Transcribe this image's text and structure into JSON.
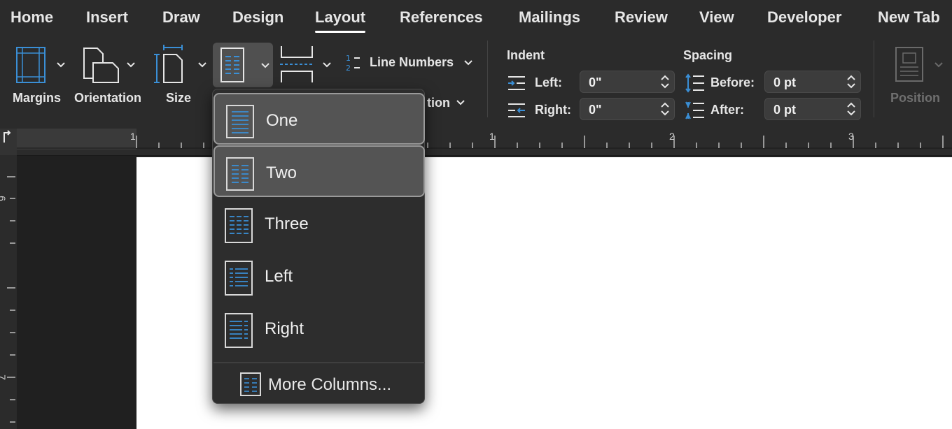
{
  "menubar": {
    "tabs": [
      {
        "label": "Home"
      },
      {
        "label": "Insert"
      },
      {
        "label": "Draw"
      },
      {
        "label": "Design"
      },
      {
        "label": "Layout",
        "active": true
      },
      {
        "label": "References"
      },
      {
        "label": "Mailings"
      },
      {
        "label": "Review"
      },
      {
        "label": "View"
      },
      {
        "label": "Developer"
      },
      {
        "label": "New Tab"
      }
    ]
  },
  "ribbon": {
    "margins_label": "Margins",
    "orientation_label": "Orientation",
    "size_label": "Size",
    "line_numbers_label": "Line Numbers",
    "hyphenation_partial": "tion",
    "indent": {
      "heading": "Indent",
      "left_label": "Left:",
      "left_value": "0\"",
      "right_label": "Right:",
      "right_value": "0\""
    },
    "spacing": {
      "heading": "Spacing",
      "before_label": "Before:",
      "before_value": "0 pt",
      "after_label": "After:",
      "after_value": "0 pt"
    },
    "position_label": "Position"
  },
  "ruler": {
    "numbers": [
      "1",
      "1",
      "2",
      "3"
    ],
    "vnumbers": [
      "6",
      "7"
    ]
  },
  "columns_menu": {
    "items": [
      {
        "label": "One"
      },
      {
        "label": "Two"
      },
      {
        "label": "Three"
      },
      {
        "label": "Left"
      },
      {
        "label": "Right"
      }
    ],
    "more_label": "More Columns..."
  },
  "colors": {
    "accent": "#3a8fd6",
    "chrome": "#2b2b2b"
  }
}
